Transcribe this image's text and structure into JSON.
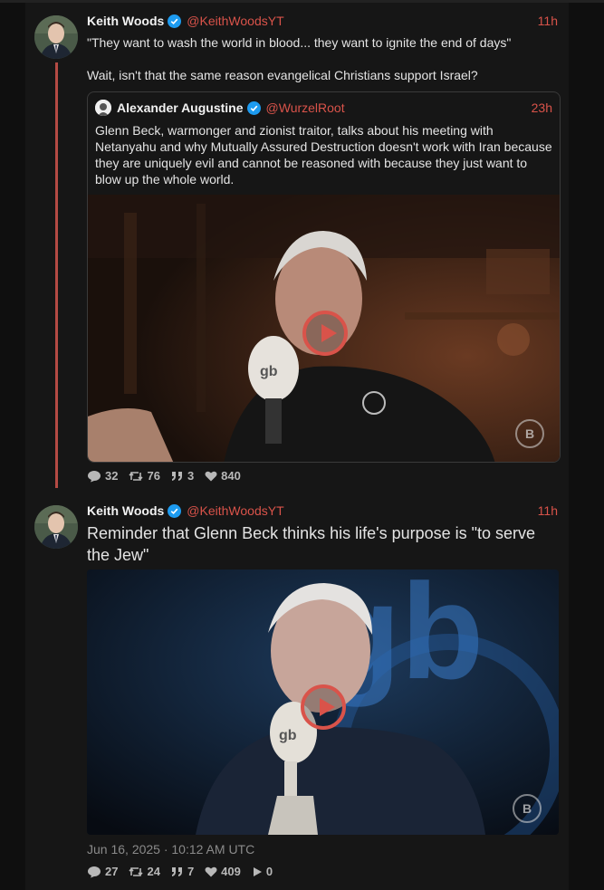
{
  "tweets": [
    {
      "author": "Keith Woods",
      "handle": "@KeithWoodsYT",
      "time": "11h",
      "text": "\"They want to wash the world in blood... they want to ignite the end of days\"\n\nWait, isn't that the same reason evangelical Christians support Israel?",
      "quote": {
        "author": "Alexander Augustine",
        "handle": "@WurzelRoot",
        "time": "23h",
        "text": "Glenn Beck, warmonger and zionist traitor, talks about his meeting with Netanyahu and why Mutually Assured Destruction doesn't work with Iran because they are uniquely evil and cannot be reasoned with because they just want to blow up the whole world."
      },
      "stats": {
        "replies": "32",
        "retweets": "76",
        "quotes": "3",
        "likes": "840"
      }
    },
    {
      "author": "Keith Woods",
      "handle": "@KeithWoodsYT",
      "time": "11h",
      "text": "Reminder that Glenn Beck thinks his life's purpose is \"to serve the Jew\"",
      "datetime": "Jun 16, 2025 · 10:12 AM UTC",
      "stats": {
        "replies": "27",
        "retweets": "24",
        "quotes": "7",
        "likes": "409",
        "views": "0"
      }
    }
  ],
  "icons": {
    "verified": "verified-badge-icon",
    "reply": "comment-icon",
    "retweet": "retweet-icon",
    "quote": "quote-icon",
    "like": "heart-icon",
    "views": "play-icon",
    "play": "play-button-icon"
  },
  "colors": {
    "accent": "#d9534a",
    "verified": "#1d9bf0",
    "background": "#0f0f0f",
    "column": "#161616"
  }
}
